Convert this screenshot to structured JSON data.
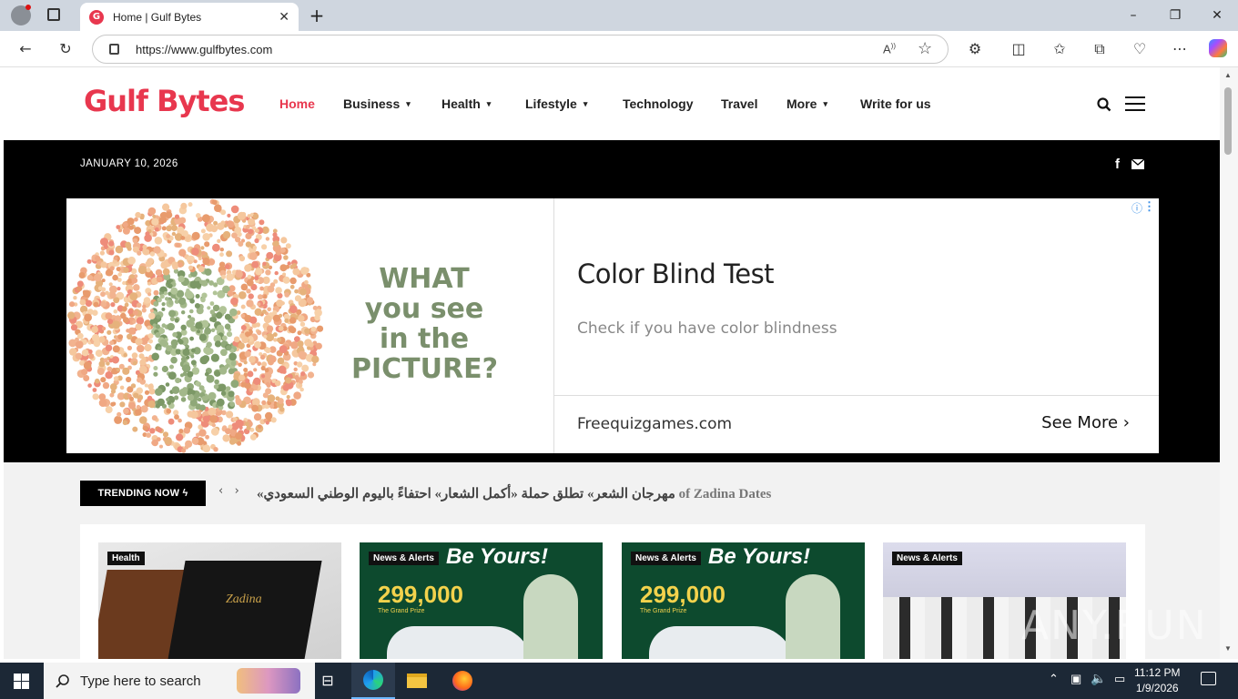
{
  "browser": {
    "tab_title": "Home | Gulf Bytes",
    "tab_favicon_letter": "G",
    "url": "https://www.gulfbytes.com"
  },
  "site": {
    "logo": "Gulf Bytes",
    "nav": [
      {
        "label": "Home",
        "active": true
      },
      {
        "label": "Business"
      },
      {
        "label": "Health"
      },
      {
        "label": "Lifestyle"
      },
      {
        "label": "Technology"
      },
      {
        "label": "Travel"
      },
      {
        "label": "More"
      },
      {
        "label": "Write for us"
      }
    ],
    "date": "JANUARY 10, 2026",
    "accent": "#e8374e"
  },
  "ad": {
    "image_text": [
      "WHAT",
      "you see",
      "in the",
      "PICTURE?"
    ],
    "title": "Color Blind Test",
    "description": "Check if you have color blindness",
    "site": "Freequizgames.com",
    "cta": "See More"
  },
  "trending": {
    "label": "TRENDING NOW",
    "headline": "«مهرجان الشعر» تطلق حملة «أكمل الشعار» احتفاءً باليوم الوطني السعودي",
    "overlay": "of Zadina Dates"
  },
  "cards": [
    {
      "category": "Health"
    },
    {
      "category": "News & Alerts",
      "prize": "299,000"
    },
    {
      "category": "News & Alerts",
      "prize": "299,000"
    },
    {
      "category": "News & Alerts"
    }
  ],
  "card_ad": {
    "title": "Be Yours!",
    "grand_prize": "The Grand Prize"
  },
  "taskbar": {
    "search_placeholder": "Type here to search",
    "time": "11:12 PM",
    "date": "1/9/2026"
  },
  "watermark": "ANY.RUN"
}
